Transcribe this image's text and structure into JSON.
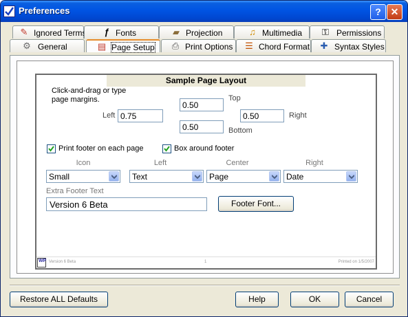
{
  "window": {
    "title": "Preferences",
    "help_label": "?",
    "close_label": "✕"
  },
  "tabs": [
    {
      "label": "Ignored Terms",
      "icon": "eraser-icon",
      "glyph": "✎",
      "color": "#c0392b"
    },
    {
      "label": "Fonts",
      "icon": "font-icon",
      "glyph": "ƒ",
      "color": "#000000"
    },
    {
      "label": "Projection",
      "icon": "projector-icon",
      "glyph": "▰",
      "color": "#8a6d3b"
    },
    {
      "label": "Multimedia",
      "icon": "music-note-icon",
      "glyph": "♫",
      "color": "#d08a00"
    },
    {
      "label": "Permissions",
      "icon": "key-icon",
      "glyph": "⚿",
      "color": "#333333"
    },
    {
      "label": "General",
      "icon": "gears-icon",
      "glyph": "⚙",
      "color": "#6c6c6c"
    },
    {
      "label": "Page Setup",
      "icon": "page-icon",
      "glyph": "▤",
      "color": "#c0392b"
    },
    {
      "label": "Print Options",
      "icon": "printer-icon",
      "glyph": "⎙",
      "color": "#555555"
    },
    {
      "label": "Chord Format",
      "icon": "chord-icon",
      "glyph": "☰",
      "color": "#c05000"
    },
    {
      "label": "Syntax Styles",
      "icon": "styles-icon",
      "glyph": "✚",
      "color": "#2a5db0"
    }
  ],
  "page_setup": {
    "banner": "Sample Page Layout",
    "hint": "Click-and-drag or type page margins.",
    "top_label": "Top",
    "top_value": "0.50",
    "left_label": "Left",
    "left_value": "0.75",
    "right_label": "Right",
    "right_value": "0.50",
    "bottom_label": "Bottom",
    "bottom_value": "0.50",
    "print_footer_label": "Print footer on each page",
    "print_footer_checked": true,
    "box_footer_label": "Box around footer",
    "box_footer_checked": true,
    "col_icon": "Icon",
    "col_left": "Left",
    "col_center": "Center",
    "col_right": "Right",
    "icon_value": "Small",
    "left_value_combo": "Text",
    "center_value": "Page",
    "right_value_combo": "Date",
    "extra_footer_label": "Extra Footer Text",
    "extra_footer_value": "Version 6 Beta",
    "footer_font_button": "Footer Font...",
    "preview_footer_left": "Version 6 Beta",
    "preview_footer_center": "1",
    "preview_footer_right": "Printed on 1/5/2007",
    "logo_text": "WP"
  },
  "buttons": {
    "restore": "Restore ALL Defaults",
    "help": "Help",
    "ok": "OK",
    "cancel": "Cancel"
  }
}
